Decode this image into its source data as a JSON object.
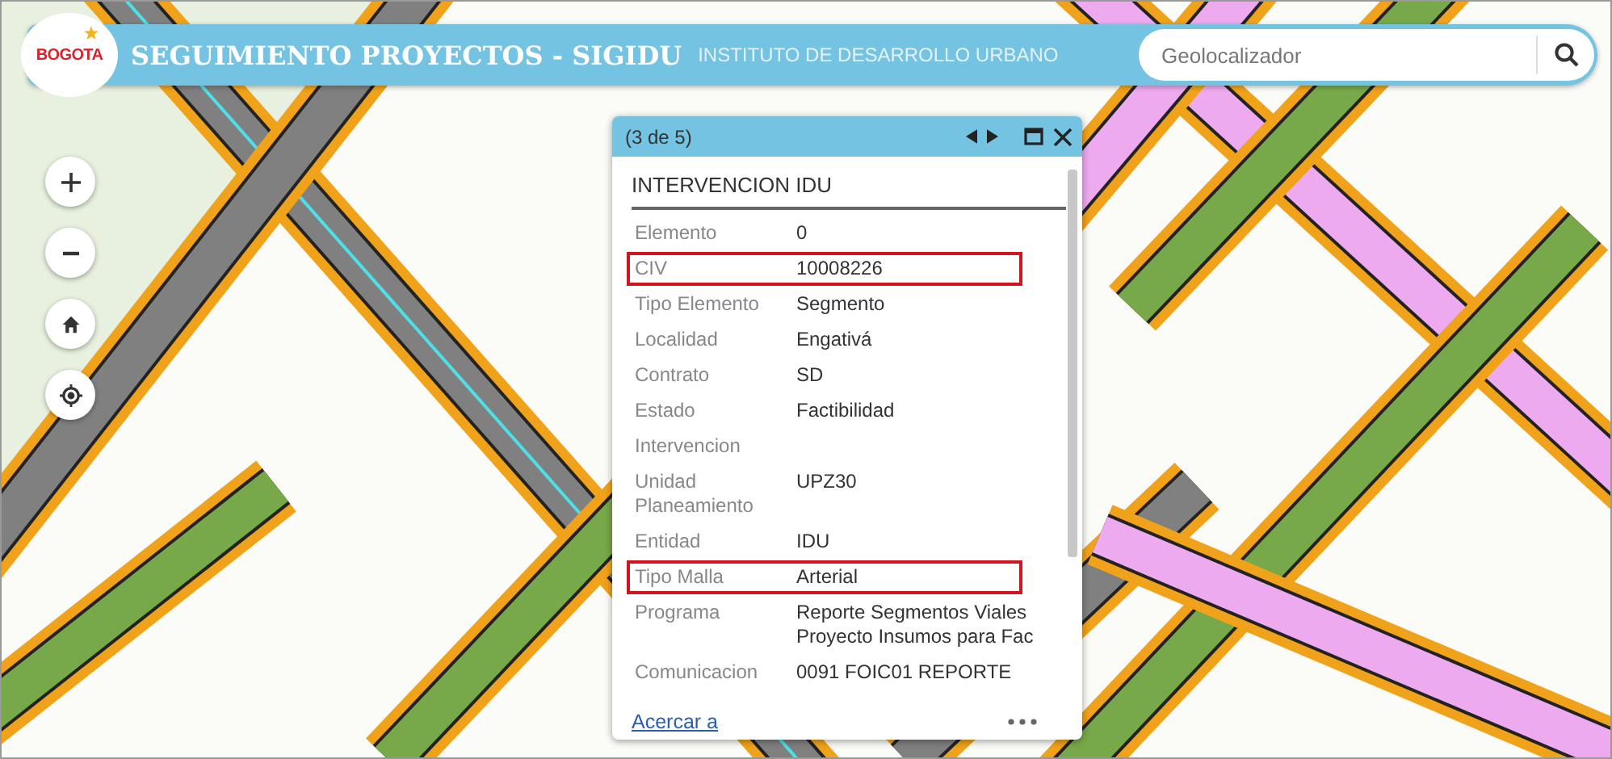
{
  "header": {
    "logo_text": "BOGOTA",
    "title": "SEGUIMIENTO PROYECTOS - SIGIDU",
    "subtitle": "INSTITUTO DE DESARROLLO URBANO",
    "search": {
      "placeholder": "Geolocalizador"
    }
  },
  "map_controls": [
    {
      "kind": "zoom-in"
    },
    {
      "kind": "zoom-out"
    },
    {
      "kind": "home"
    },
    {
      "kind": "locate"
    }
  ],
  "popup": {
    "counter": "(3 de 5)",
    "title": "INTERVENCION IDU",
    "fields": [
      {
        "label": "Elemento",
        "value": "0",
        "highlighted": false
      },
      {
        "label": "CIV",
        "value": "10008226",
        "highlighted": true
      },
      {
        "label": "Tipo Elemento",
        "value": "Segmento",
        "highlighted": false
      },
      {
        "label": "Localidad",
        "value": "Engativá",
        "highlighted": false
      },
      {
        "label": "Contrato",
        "value": "SD",
        "highlighted": false
      },
      {
        "label": "Estado",
        "value": "Factibilidad",
        "highlighted": false
      },
      {
        "label": "Intervencion",
        "highlighted": false
      },
      {
        "label": "Unidad Planeamiento",
        "value": "UPZ30",
        "highlighted": false
      },
      {
        "label": "Entidad",
        "value": "IDU",
        "highlighted": false
      },
      {
        "label": "Tipo Malla",
        "value": "Arterial",
        "highlighted": true
      },
      {
        "label": "Programa",
        "value": "Reporte Segmentos Viales Proyecto Insumos para Fac",
        "highlighted": false
      },
      {
        "label": "Comunicacion",
        "value": "0091  FOIC01  REPORTE",
        "highlighted": false
      }
    ],
    "zoom_link": "Acercar a"
  }
}
